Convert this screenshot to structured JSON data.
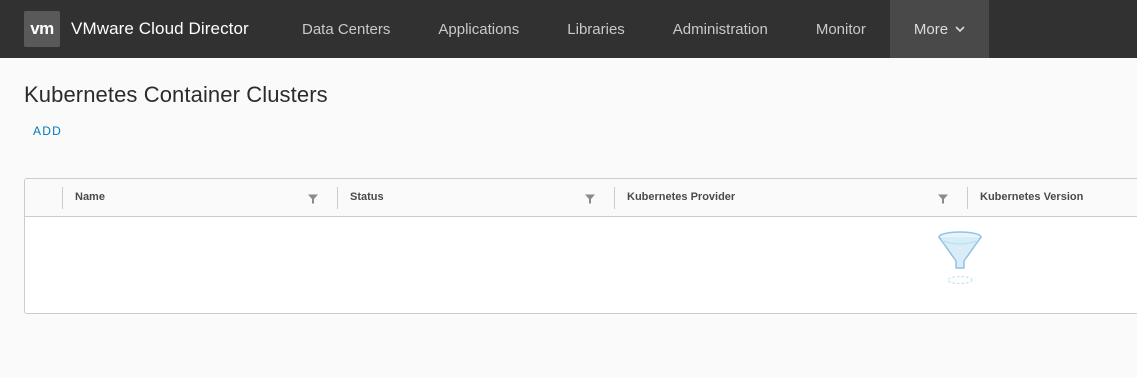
{
  "header": {
    "logo_text": "vm",
    "app_title": "VMware Cloud Director",
    "nav": [
      {
        "label": "Data Centers"
      },
      {
        "label": "Applications"
      },
      {
        "label": "Libraries"
      },
      {
        "label": "Administration"
      },
      {
        "label": "Monitor"
      },
      {
        "label": "More",
        "icon": "chevron-down-icon"
      }
    ]
  },
  "page": {
    "title": "Kubernetes Container Clusters",
    "add_label": "ADD"
  },
  "grid": {
    "columns": [
      {
        "label": "Name",
        "filter_icon": "filter-icon"
      },
      {
        "label": "Status",
        "filter_icon": "filter-icon"
      },
      {
        "label": "Kubernetes Provider",
        "filter_icon": "filter-icon"
      },
      {
        "label": "Kubernetes Version"
      }
    ],
    "rows": [],
    "empty_icon": "empty-filter-funnel-icon"
  },
  "colors": {
    "header_bg": "#313131",
    "more_bg": "#494949",
    "link": "#0079b8",
    "border": "#cccccc",
    "funnel": "#8fc3e3"
  }
}
